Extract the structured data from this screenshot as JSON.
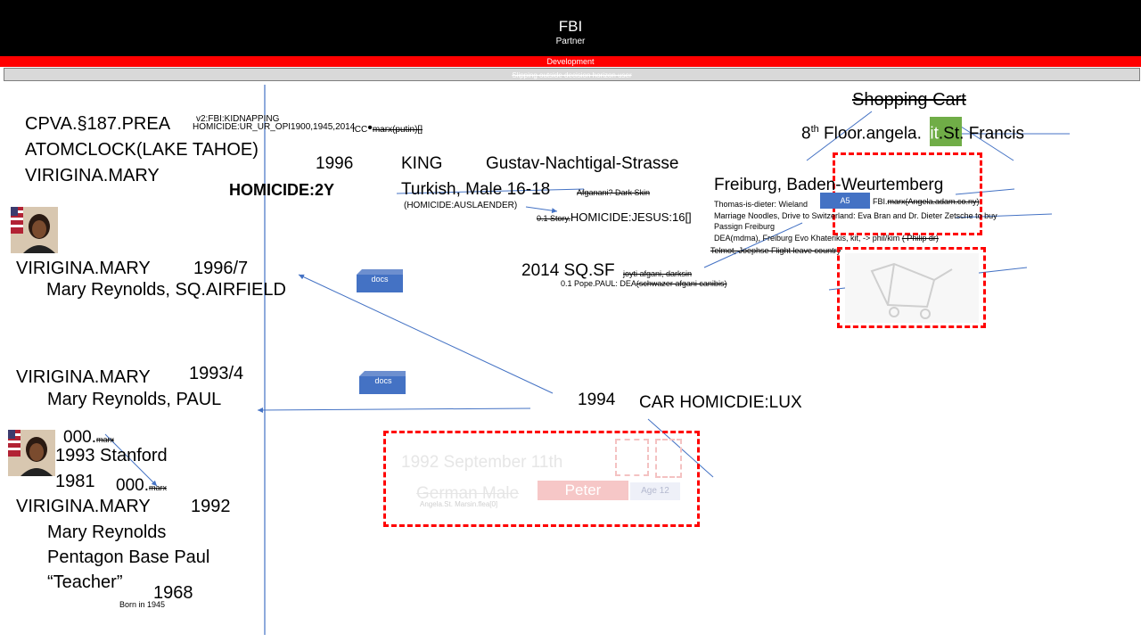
{
  "header": {
    "title": "FBI",
    "subtitle": "Partner",
    "development": "Development",
    "status_strip": "Slipping outside decision horizon user"
  },
  "left": {
    "line1": "CPVA.§187.PREA",
    "line2": "ATOMCLOCK(LAKE TAHOE)",
    "line3": "VIRIGINA.MARY",
    "v2": "v2:FBI:KIDNAPPING",
    "homicide_ur": "HOMICIDE:UR_UR_OPI1900,1945,2014",
    "icc": "ICC",
    "marx_putin": "marx(putin)[]",
    "homicide_2y": "HOMICIDE:2Y",
    "block1_name": "VIRIGINA.MARY",
    "block1_year": "1996/7",
    "block1_sub": "Mary Reynolds, SQ.AIRFIELD",
    "block2_name": "VIRIGINA.MARY",
    "block2_year": "1993/4",
    "block2_sub": "Mary Reynolds, PAUL",
    "zero1": "000.",
    "marx1": "marx",
    "stanford": "1993 Stanford",
    "y1981": "1981",
    "zero2": "000.",
    "marx2": "marx",
    "block3_name": "VIRIGINA.MARY",
    "block3_year": "1992",
    "block3_l1": "Mary Reynolds",
    "block3_l2": "Pentagon Base Paul",
    "block3_l3": "“Teacher”",
    "y1968": "1968",
    "born": "Born in 1945"
  },
  "middle": {
    "y1996": "1996",
    "king": "KING",
    "gustav": "Gustav-Nachtigal-Strasse",
    "turkish": "Turkish, Male 16-18",
    "afganani": "Afganani? Dark Skin",
    "auslaender": "(HOMICIDE:AUSLAENDER)",
    "story_prefix": "0.1 Story.",
    "story": "HOMICIDE:JESUS:16[]",
    "docs1": "docs",
    "docs2": "docs",
    "sqsf": "2014 SQ.SF",
    "joyti": "joyti afgani, darksin",
    "pope": "0.1 Pope.PAUL: DEA",
    "schwazer": "(schwazer afgani canibis)",
    "y1994": "1994",
    "car": "CAR HOMICDIE:LUX",
    "faded_date": "1992  September 11th",
    "faded_german": "German Male",
    "faded_peter": "Peter",
    "faded_age": "Age 12",
    "faded_small": "Angela.St. Marsin.flea[0]"
  },
  "right": {
    "cart": "Shopping Cart",
    "floor_prefix": "8",
    "floor_sup": "th",
    "floor_text": " Floor.angela.",
    "kit": "kit",
    "francis": ".St. Francis",
    "freiburg": "Freiburg, Baden-Weurtemberg",
    "a5": "A5",
    "thomas": "Thomas-is-dieter: Wieland",
    "fbi_marx": "FBI.",
    "marx_angela": "marx(Angela.adam.co.ny)",
    "marriage": "Marriage Noodles, Drive to Switzerland: Eva Bran and Dr. Dieter Zetsche to buy",
    "passign": "Passign Freiburg",
    "dea": "DEA(mdma), Freiburg  Evo Khaterikis, kit,  -> phil/kim",
    "philip": "( Philip dr)",
    "telmot": "Telmot, Joephse Flight leave country"
  },
  "colors": {
    "header_bg": "#000000",
    "red": "#ff0000",
    "docs_blue": "#4472c4",
    "kit_green": "#70ad47",
    "line_blue": "#4472c4"
  }
}
